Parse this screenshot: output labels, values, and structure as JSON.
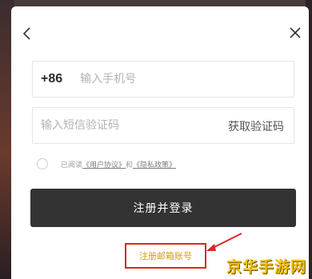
{
  "modal": {
    "back_icon": "chevron-left-icon",
    "close_icon": "close-icon"
  },
  "phone": {
    "country_code": "+86",
    "placeholder": "输入手机号",
    "value": ""
  },
  "verification": {
    "placeholder": "输入短信验证码",
    "value": "",
    "get_code_label": "获取验证码"
  },
  "agreement": {
    "checked": false,
    "prefix": "已阅读",
    "user_agreement": "《用户协议》",
    "and": "和",
    "privacy_policy": "《隐私政策》"
  },
  "actions": {
    "submit_label": "注册并登录",
    "email_register_label": "注册邮箱账号"
  },
  "watermark": {
    "text": "京华手游网"
  },
  "colors": {
    "button_bg": "#333333",
    "highlight_box": "#e02424",
    "email_link": "#d79a1c",
    "watermark": "#f2c200"
  }
}
